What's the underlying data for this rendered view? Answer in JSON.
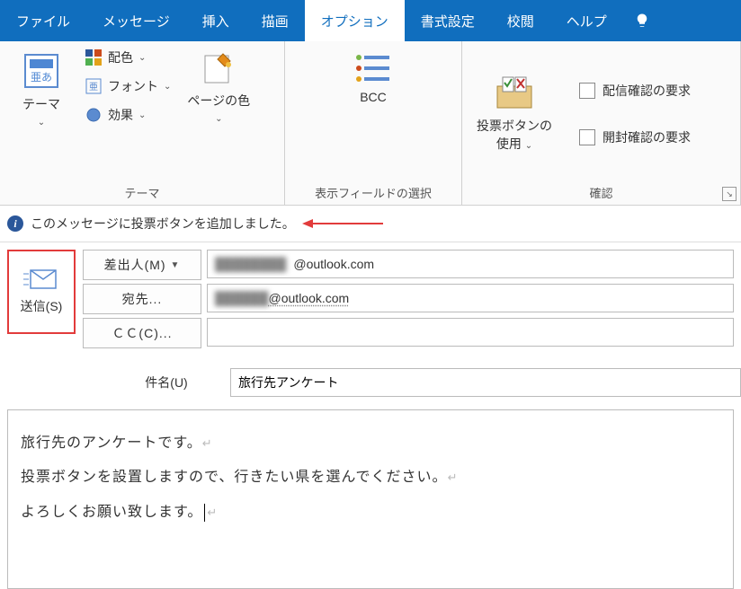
{
  "tabs": {
    "file": "ファイル",
    "message": "メッセージ",
    "insert": "挿入",
    "draw": "描画",
    "options": "オプション",
    "format": "書式設定",
    "review": "校閲",
    "help": "ヘルプ"
  },
  "ribbon": {
    "theme": {
      "theme_large": "テーマ",
      "colors": "配色",
      "fonts": "フォント",
      "effects": "効果",
      "page_color": "ページの色",
      "group_label": "テーマ"
    },
    "fields": {
      "bcc": "BCC",
      "group_label": "表示フィールドの選択"
    },
    "voting": {
      "use_voting": "投票ボタンの\n使用",
      "delivery_receipt": "配信確認の要求",
      "read_receipt": "開封確認の要求",
      "group_label": "確認"
    }
  },
  "info_bar": {
    "text": "このメッセージに投票ボタンを追加しました。"
  },
  "compose": {
    "send": "送信(S)",
    "from": "差出人(M)",
    "from_value_suffix": "@outlook.com",
    "to": "宛先...",
    "to_value_suffix": "@outlook.com",
    "cc": "ＣＣ(C)...",
    "subject_label": "件名(U)",
    "subject_value": "旅行先アンケート"
  },
  "body": {
    "line1": "旅行先のアンケートです。",
    "line2": "投票ボタンを設置しますので、行きたい県を選んでください。",
    "line3": "よろしくお願い致します。"
  }
}
